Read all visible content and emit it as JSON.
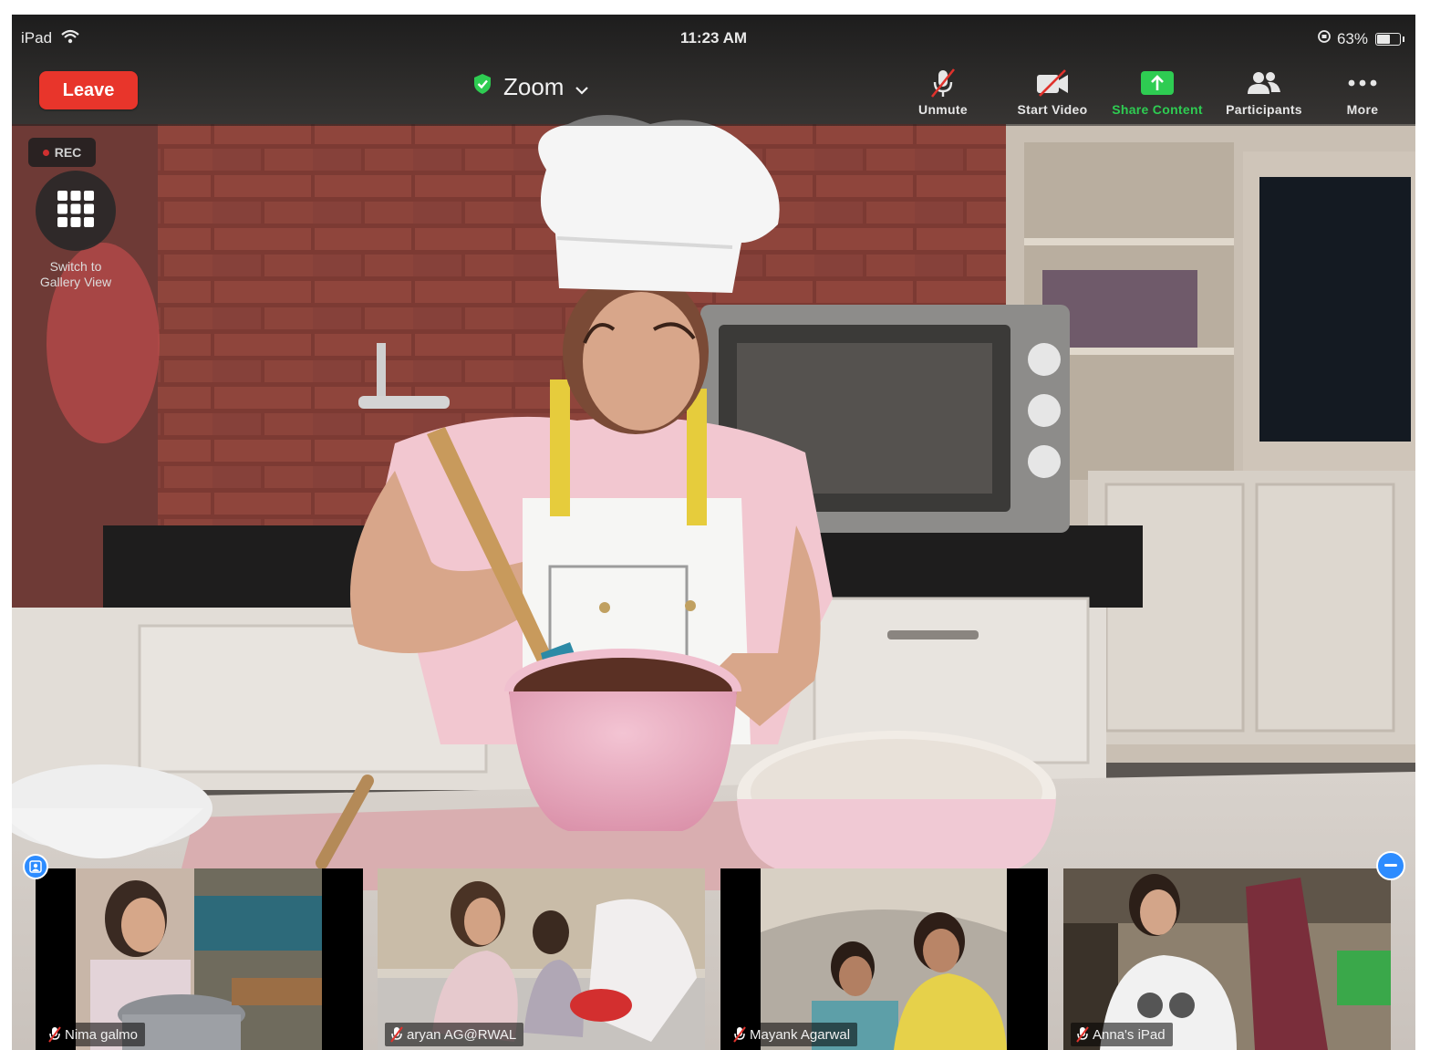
{
  "status_bar": {
    "device": "iPad",
    "time": "11:23 AM",
    "battery_percent": "63%",
    "battery_level": 0.63
  },
  "toolbar": {
    "leave_label": "Leave",
    "meeting_title": "Zoom",
    "buttons": {
      "unmute": "Unmute",
      "start_video": "Start Video",
      "share_content": "Share Content",
      "participants": "Participants",
      "more": "More"
    },
    "colors": {
      "leave": "#e8352b",
      "share": "#2ecc52",
      "encryption": "#2ecc52",
      "accent": "#2d8cff"
    }
  },
  "overlay": {
    "rec_label": "REC",
    "gallery_switch_label": "Switch to Gallery View"
  },
  "icons": {
    "wifi": "wifi-icon",
    "shield": "shield-check-icon",
    "mic_off": "mic-muted-icon",
    "video_off": "video-off-icon",
    "share": "share-up-arrow-icon",
    "participants": "participants-icon",
    "more": "ellipsis-icon",
    "grid": "grid-icon",
    "pin": "pin-icon",
    "collapse": "minus-circle-icon"
  },
  "participants": [
    {
      "name": "Nima galmo",
      "muted": true
    },
    {
      "name": "aryan AG@RWAL",
      "muted": true
    },
    {
      "name": "Mayank Agarwal",
      "muted": true
    },
    {
      "name": "Anna's iPad",
      "muted": true
    }
  ]
}
